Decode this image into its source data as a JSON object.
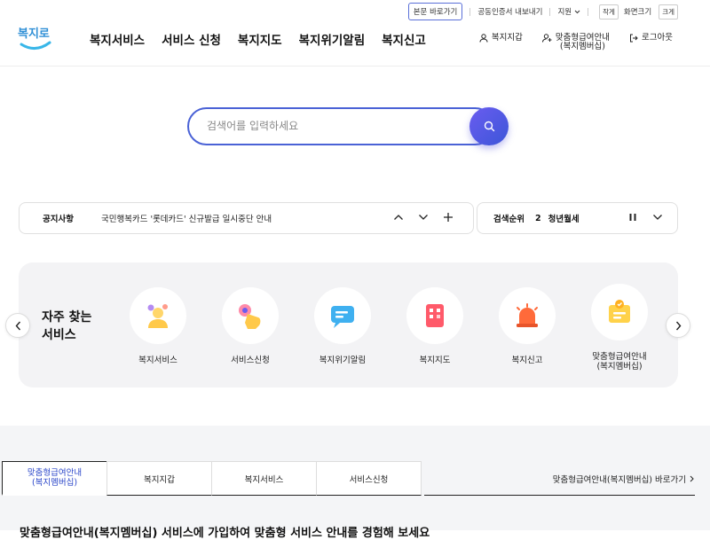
{
  "utility": {
    "skip_link": "본문 바로가기",
    "cert_export": "공동인증서 내보내기",
    "support": "지원",
    "font_small": "작게",
    "font_size_label": "화면크기",
    "font_large": "크게"
  },
  "logo": {
    "text": "복지로",
    "color": "#3aa0e0"
  },
  "nav": {
    "items": [
      "복지서비스",
      "서비스 신청",
      "복지지도",
      "복지위기알림",
      "복지신고"
    ]
  },
  "header_right": {
    "wallet": "복지지갑",
    "membership_line1": "맞춤형급여안내",
    "membership_line2": "(복지멤버십)",
    "logout": "로그아웃"
  },
  "search": {
    "placeholder": "검색어를 입력하세요",
    "value": ""
  },
  "notice": {
    "label": "공지사항",
    "message": "국민행복카드 '롯데카드' 신규발급 일시중단 안내"
  },
  "ranking": {
    "label": "검색순위",
    "rank": "2",
    "keyword": "청년월세"
  },
  "quick": {
    "title_line1": "자주 찾는",
    "title_line2": "서비스",
    "items": [
      {
        "label": "복지서비스",
        "icon": "people-icon"
      },
      {
        "label": "서비스신청",
        "icon": "hand-click-icon"
      },
      {
        "label": "복지위기알림",
        "icon": "chat-bubble-icon"
      },
      {
        "label": "복지지도",
        "icon": "building-icon"
      },
      {
        "label": "복지신고",
        "icon": "siren-icon"
      },
      {
        "label_line1": "맞춤형급여안내",
        "label_line2": "(복지멤버십)",
        "icon": "id-card-icon"
      }
    ]
  },
  "tabs": {
    "items": [
      {
        "line1": "맞춤형급여안내",
        "line2": "(복지멤버십)"
      },
      {
        "line1": "복지지갑"
      },
      {
        "line1": "복지서비스"
      },
      {
        "line1": "서비스신청"
      }
    ],
    "goto": "맞춤형급여안내(복지멤버십) 바로가기",
    "description": "맞춤형급여안내(복지멤버십) 서비스에 가입하여 맞춤형 서비스 안내를 경험해 보세요"
  },
  "colors": {
    "accent": "#4a62d6",
    "active_tab": "#2a46c9"
  }
}
